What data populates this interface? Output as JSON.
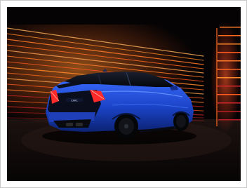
{
  "image": {
    "subject": "blue-hatchback-car-rear-three-quarter-view",
    "badge_text": "CIVIC",
    "colors": {
      "background": "#050304",
      "frame_border": "#c9c9c9",
      "car_body": "#1f4fd8",
      "car_highlight": "#4f86ff",
      "light_streak_orange": "#ff7a2a",
      "light_streak_red": "#d6262b",
      "floor": "#16100f"
    }
  }
}
